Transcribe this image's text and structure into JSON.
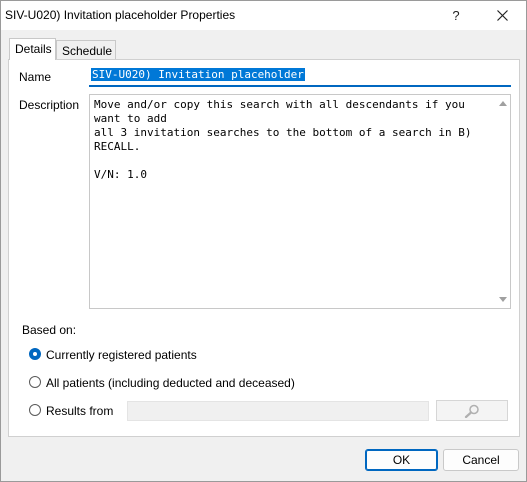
{
  "window": {
    "title": "SIV-U020) Invitation placeholder Properties",
    "help_glyph": "?",
    "close_icon": "close-icon"
  },
  "tabs": [
    {
      "label": "Details",
      "selected": true
    },
    {
      "label": "Schedule",
      "selected": false
    }
  ],
  "details": {
    "name_label": "Name",
    "name_value": "SIV-U020) Invitation placeholder",
    "description_label": "Description",
    "description_value": "Move and/or copy this search with all descendants if you want to add\nall 3 invitation searches to the bottom of a search in B) RECALL.\n\nV/N: 1.0",
    "based_on_label": "Based on:",
    "options": [
      {
        "label": "Currently registered patients",
        "checked": true
      },
      {
        "label": "All patients (including deducted and deceased)",
        "checked": false
      },
      {
        "label": "Results from",
        "checked": false
      }
    ],
    "results_from_value": "",
    "search_icon": "magnifier-icon"
  },
  "buttons": {
    "ok_label": "OK",
    "cancel_label": "Cancel"
  },
  "colors": {
    "accent": "#0067c0",
    "selection": "#0078d7"
  }
}
